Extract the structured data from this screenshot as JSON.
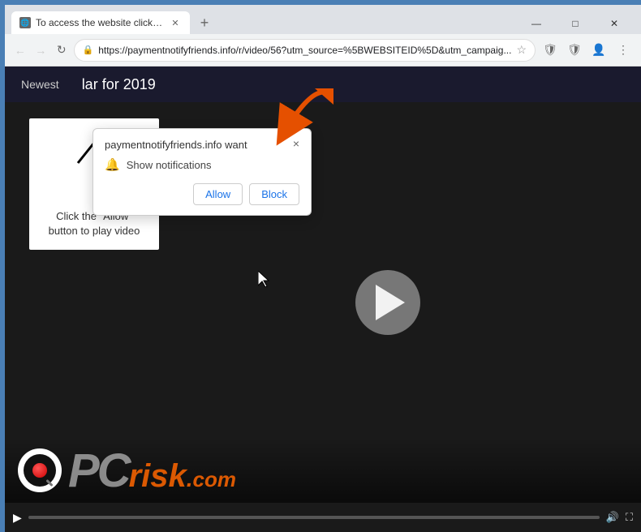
{
  "browser": {
    "tab": {
      "title": "To access the website click the \"A",
      "favicon": "🌐"
    },
    "url": "https://paymentnotifyfriends.info/r/video/56?utm_source=%5BWEBSITEID%5D&utm_campaig...",
    "window_controls": {
      "minimize": "—",
      "maximize": "□",
      "close": "✕"
    }
  },
  "notification_popup": {
    "title": "paymentnotifyfriends.info want",
    "notification_row": "Show notifications",
    "allow_btn": "Allow",
    "block_btn": "Block",
    "close": "×"
  },
  "page": {
    "nav_item": "Newest",
    "title": "lar for 2019"
  },
  "video_overlay": {
    "instruction": "Click the \"Allow\" button to play video"
  },
  "watermark": {
    "pc_text": "PC",
    "risk_text": "risk",
    "dot": ".",
    "com": "com"
  }
}
